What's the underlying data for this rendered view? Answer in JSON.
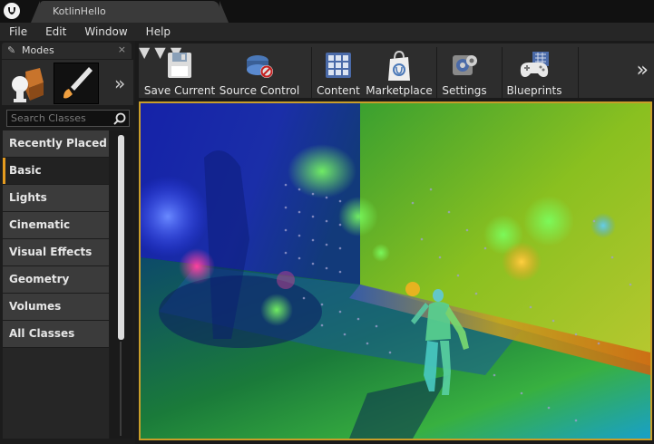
{
  "window": {
    "tab_title": "KotlinHello"
  },
  "menu": {
    "items": [
      "File",
      "Edit",
      "Window",
      "Help"
    ]
  },
  "modes": {
    "title": "Modes",
    "search_placeholder": "Search Classes",
    "categories": [
      "Recently Placed",
      "Basic",
      "Lights",
      "Cinematic",
      "Visual Effects",
      "Geometry",
      "Volumes",
      "All Classes"
    ],
    "active_category": "Basic"
  },
  "toolbar": {
    "save_current": "Save Current",
    "source_control": "Source Control",
    "content": "Content",
    "marketplace": "Marketplace",
    "settings": "Settings",
    "blueprints": "Blueprints"
  },
  "colors": {
    "accent": "#e49b1f",
    "viewport_border": "#c99e2a"
  }
}
